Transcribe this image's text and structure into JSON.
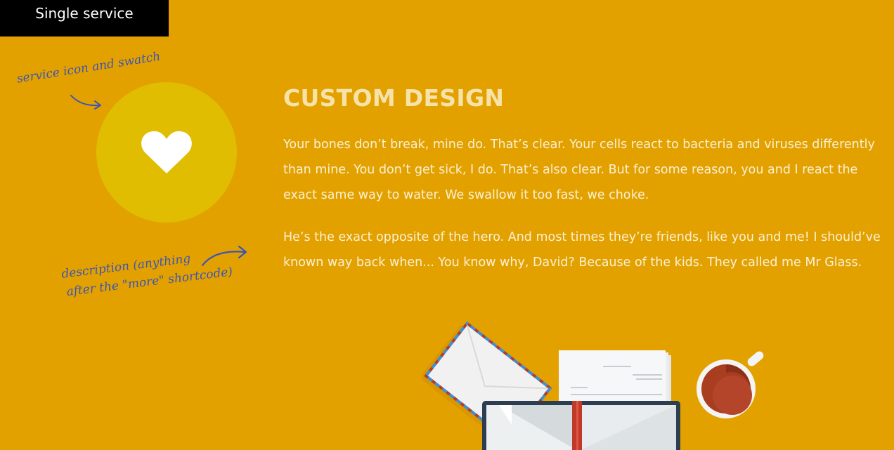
{
  "header": {
    "label": "Single service"
  },
  "annotations": {
    "icon_note": "service icon and swatch",
    "desc_note_line1": "description (anything",
    "desc_note_line2": "after the \"more\" shortcode)"
  },
  "service": {
    "icon": "heart-icon",
    "swatch_color": "#e0bd00",
    "title": "CUSTOM DESIGN",
    "paragraphs": [
      "Your bones don’t break, mine do. That’s clear. Your cells react to bacteria and viruses differently than mine. You don’t get sick, I do. That’s also clear. But for some reason, you and I react the exact same way to water. We swallow it too fast, we choke.",
      "He’s the exact opposite of the hero. And most times they’re friends, like you and me! I should’ve known way back when... You know why, David? Because of the kids. They called me Mr Glass."
    ]
  },
  "colors": {
    "background": "#e3a100",
    "annotation": "#3b55b5",
    "title": "#f7e2aa"
  }
}
